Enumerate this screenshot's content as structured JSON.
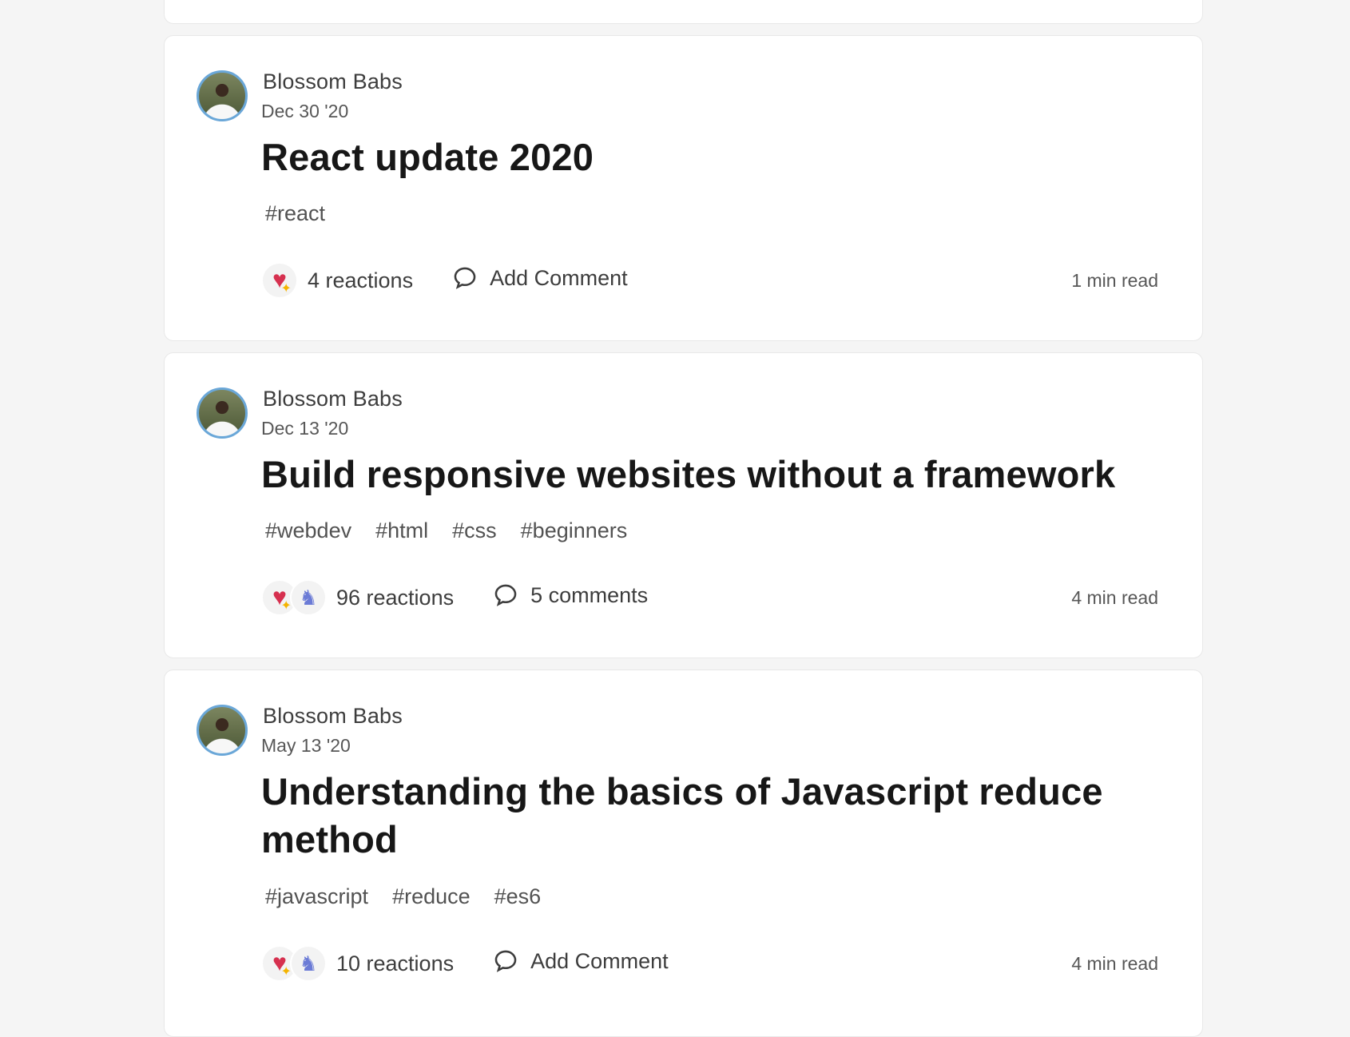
{
  "posts": [
    {
      "author": "Blossom Babs",
      "date": "Dec 30 '20",
      "title": "React update 2020",
      "tags": [
        "#react"
      ],
      "reaction_icons": [
        "sparkle-heart",
        "unicorn"
      ],
      "reactions": "4 reactions",
      "comments": "Add Comment",
      "read_time": "1 min read"
    },
    {
      "author": "Blossom Babs",
      "date": "Dec 13 '20",
      "title": "Build responsive websites without a framework",
      "tags": [
        "#webdev",
        "#html",
        "#css",
        "#beginners"
      ],
      "reaction_icons": [
        "sparkle-heart",
        "unicorn"
      ],
      "reactions": "96 reactions",
      "comments": "5 comments",
      "read_time": "4 min read"
    },
    {
      "author": "Blossom Babs",
      "date": "May 13 '20",
      "title": "Understanding the basics of Javascript reduce method",
      "tags": [
        "#javascript",
        "#reduce",
        "#es6"
      ],
      "reaction_icons": [
        "sparkle-heart",
        "unicorn"
      ],
      "reactions": "10 reactions",
      "comments": "Add Comment",
      "read_time": "4 min read"
    }
  ],
  "colors": {
    "page_background": "#f5f5f5",
    "card_background": "#ffffff",
    "heart": "#d6304f",
    "avatar_ring": "#6aa7d8"
  }
}
